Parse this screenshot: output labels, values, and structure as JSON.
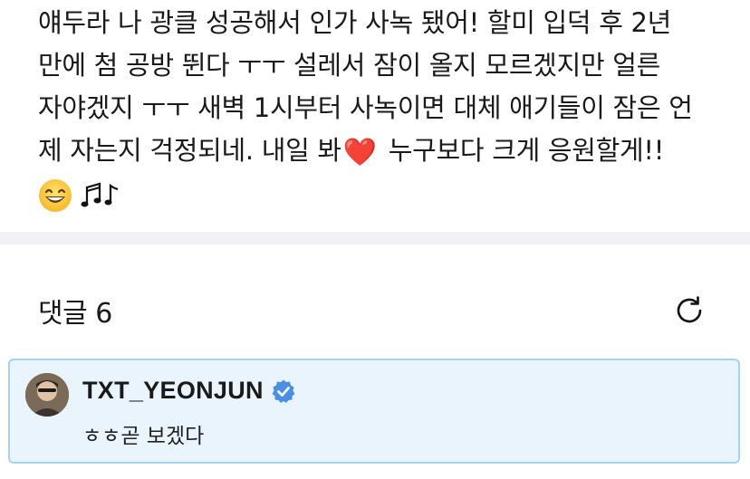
{
  "post": {
    "lines": [
      "얘두라 나 광클 성공해서 인가 사녹 됐어! 할미 입덕 후 2년",
      "만에 첨 공방 뛴다 ㅜㅜ 설레서 잠이 올지 모르겠지만 얼른",
      "자야겠지 ㅜㅜ 새벽 1시부터 사녹이면 대체 애기들이 잠은 언",
      "제 자는지 걱정되네. 내일 봐",
      " 누구보다 크게 응원할게!!"
    ],
    "heart_emoji": "❤️",
    "grin_emoji": "grinning-face-icon",
    "notes_emoji": "musical-notes-icon"
  },
  "comments": {
    "title": "댓글 6",
    "refresh_icon": "refresh-icon"
  },
  "comment": {
    "author": "TXT_YEONJUN",
    "verified_icon": "verified-badge-icon",
    "text": "ㅎㅎ곧 보겠다",
    "highlight_bg": "#eaf4fc",
    "highlight_border": "#a8d2f2"
  },
  "colors": {
    "text": "#1a1a1a",
    "heart": "#e0252c",
    "verified": "#4a90e2",
    "divider": "#f1f2f5"
  }
}
